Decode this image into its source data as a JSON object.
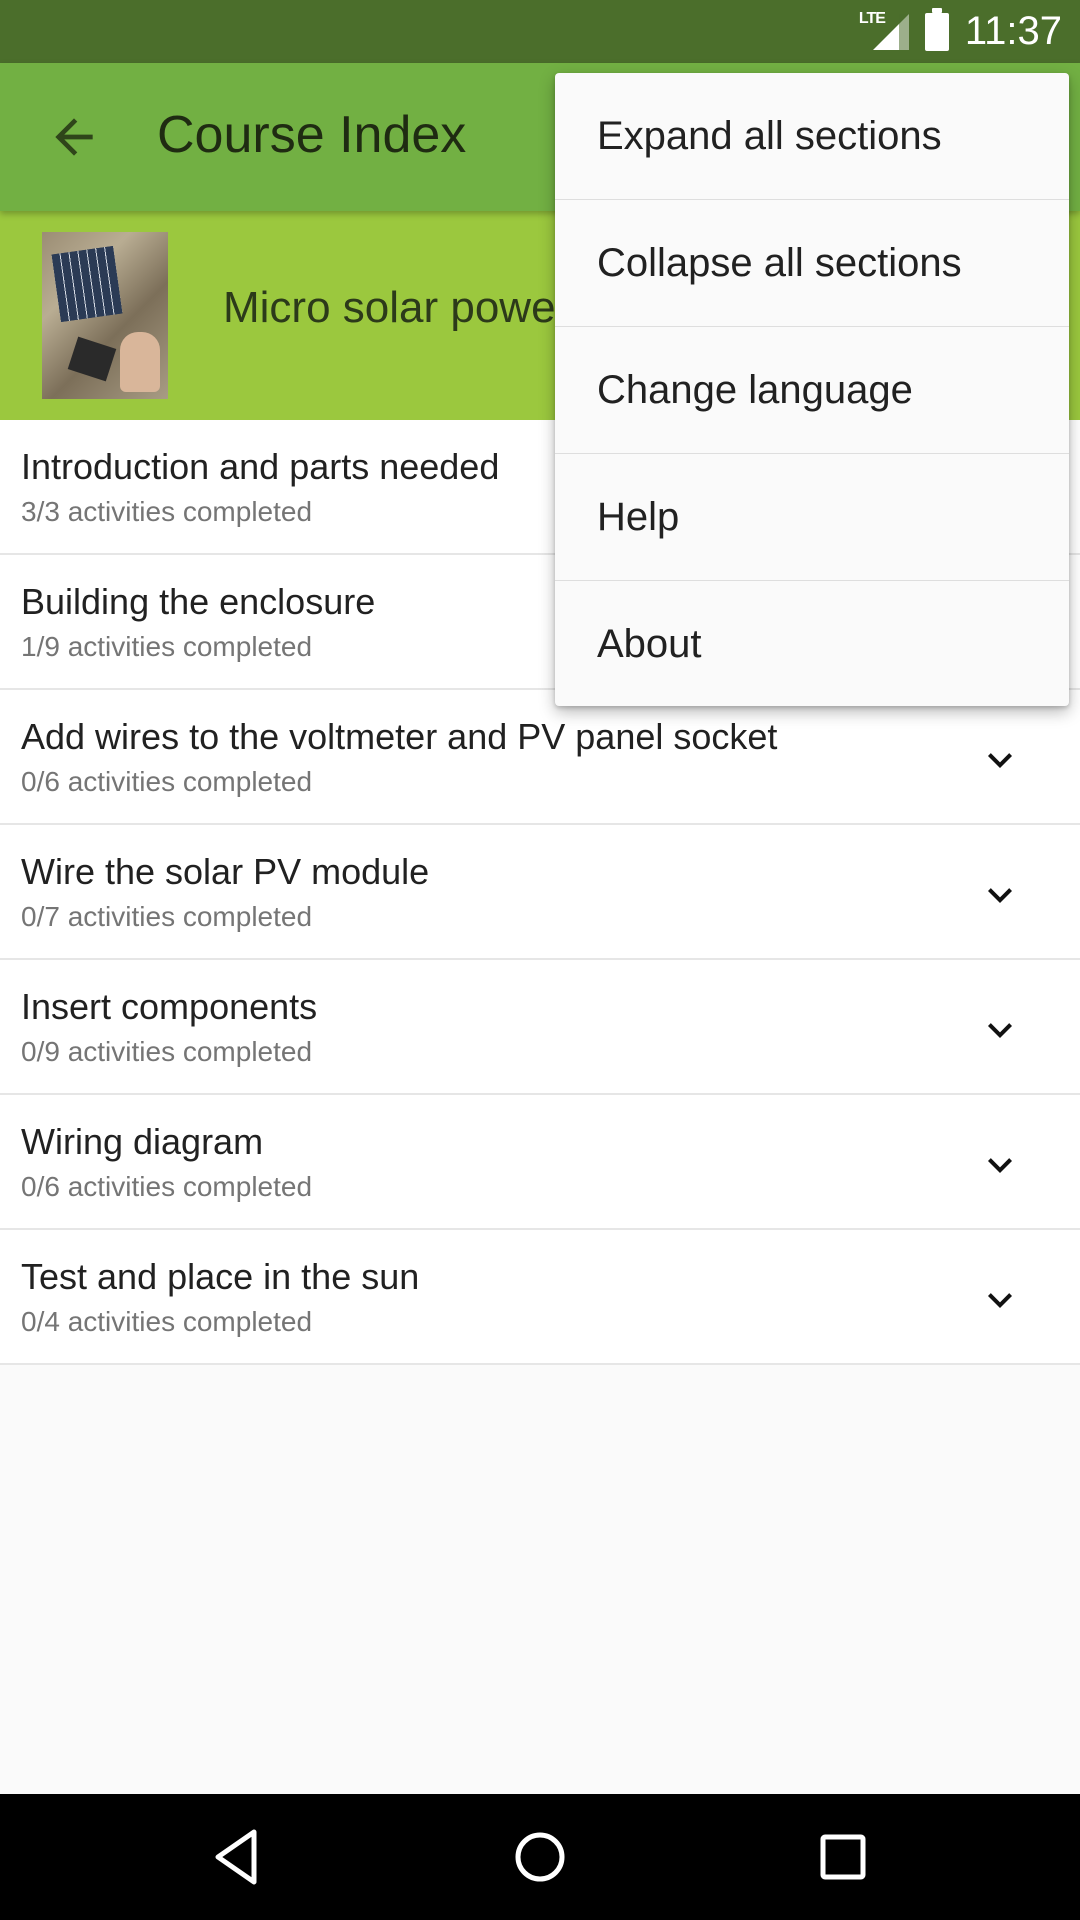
{
  "status_bar": {
    "network": "LTE",
    "time": "11:37"
  },
  "toolbar": {
    "title": "Course Index"
  },
  "course": {
    "title": "Micro solar power"
  },
  "sections": [
    {
      "title": "Introduction and parts needed",
      "progress": "3/3  activities completed"
    },
    {
      "title": "Building the enclosure",
      "progress": "1/9  activities completed"
    },
    {
      "title": "Add wires to the voltmeter and PV panel socket",
      "progress": "0/6  activities completed"
    },
    {
      "title": "Wire the solar PV module",
      "progress": "0/7  activities completed"
    },
    {
      "title": "Insert components",
      "progress": "0/9  activities completed"
    },
    {
      "title": "Wiring diagram",
      "progress": "0/6  activities completed"
    },
    {
      "title": "Test and place in the sun",
      "progress": "0/4  activities completed"
    }
  ],
  "menu": {
    "items": [
      "Expand all sections",
      "Collapse all sections",
      "Change language",
      "Help",
      "About"
    ]
  },
  "colors": {
    "status_bar": "#4b6e2b",
    "toolbar": "#72b043",
    "course_header": "#9bc83e"
  }
}
